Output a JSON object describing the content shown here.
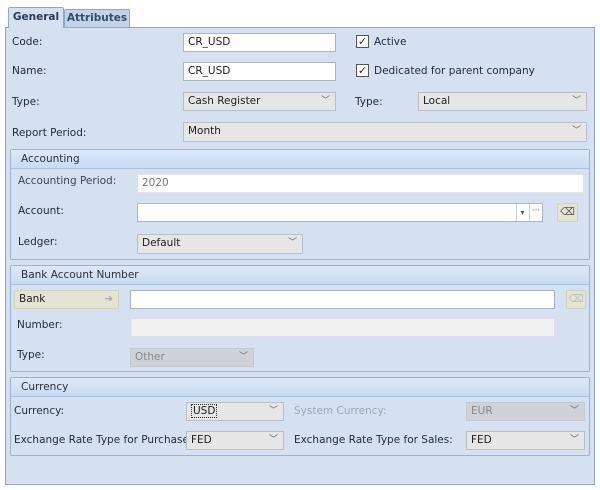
{
  "tabs": [
    {
      "label": "General",
      "active": true
    },
    {
      "label": "Attributes",
      "active": false
    }
  ],
  "general": {
    "code_label": "Code:",
    "code_value": "CR_USD",
    "name_label": "Name:",
    "name_value": "CR_USD",
    "type_label": "Type:",
    "type_value": "Cash Register",
    "report_period_label": "Report Period:",
    "report_period_value": "Month",
    "active_label": "Active",
    "active_checked": true,
    "dedicated_label": "Dedicated for parent company",
    "dedicated_checked": true,
    "type2_label": "Type:",
    "type2_value": "Local"
  },
  "accounting": {
    "title": "Accounting",
    "period_label": "Accounting Period:",
    "period_value": "2020",
    "account_label": "Account:",
    "account_value": "",
    "ledger_label": "Ledger:",
    "ledger_value": "Default"
  },
  "bank_account": {
    "title": "Bank Account Number",
    "bank_button": "Bank",
    "bank_value": "",
    "number_label": "Number:",
    "number_value": "",
    "type_label": "Type:",
    "type_value": "Other"
  },
  "currency": {
    "title": "Currency",
    "currency_label": "Currency:",
    "currency_value": "USD",
    "system_currency_label": "System Currency:",
    "system_currency_value": "EUR",
    "purchase_label": "Exchange Rate Type for Purchase:",
    "purchase_value": "FED",
    "sales_label": "Exchange Rate Type for Sales:",
    "sales_value": "FED"
  },
  "colors": {
    "panel": "#d5e1f0",
    "border": "#8fa8c8"
  }
}
